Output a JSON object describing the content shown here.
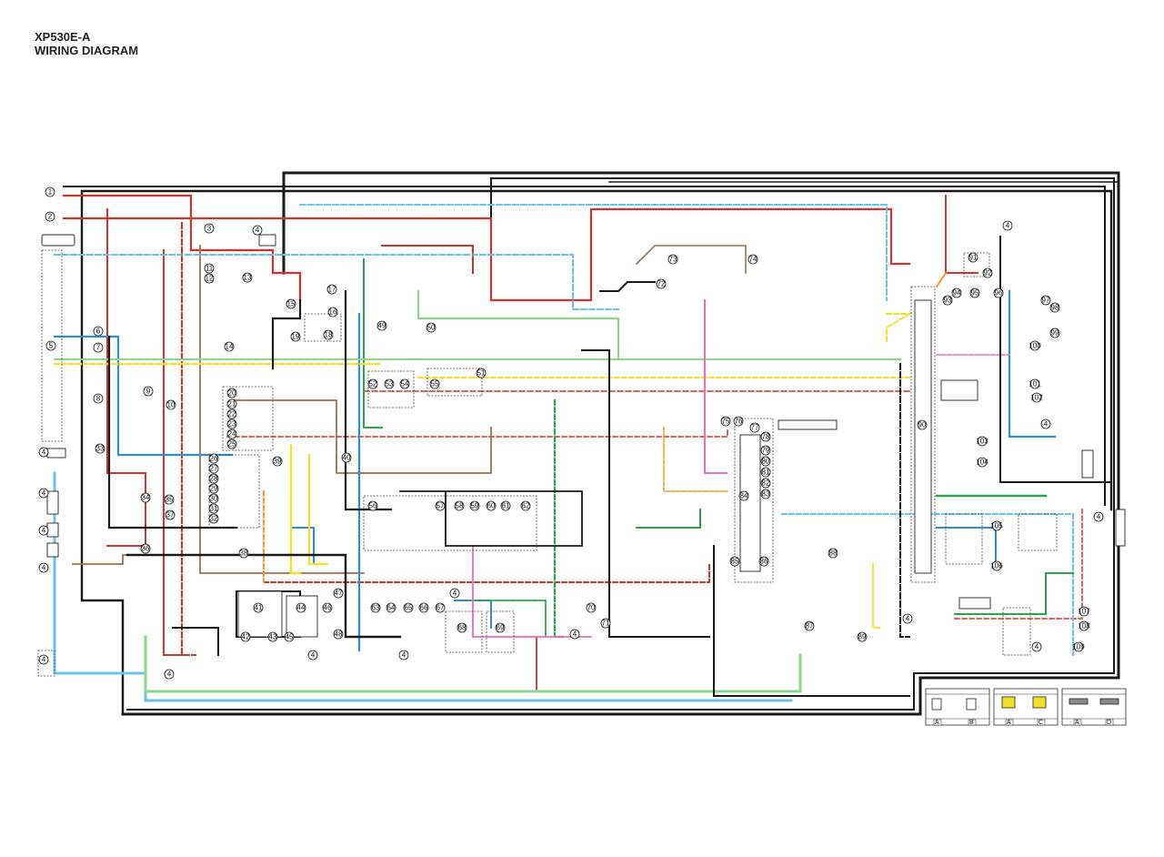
{
  "header": {
    "model": "XP530E-A",
    "title": "WIRING DIAGRAM"
  },
  "colors": {
    "black": "#1a1a1a",
    "red": "#d0342c",
    "brown": "#a0704a",
    "blue": "#2f8fd6",
    "sky_blue": "#6cc3e6",
    "green": "#2aa64a",
    "light_green": "#8fd38f",
    "yellow": "#f4df2a",
    "orange": "#f39a2b",
    "pink": "#e86fb8",
    "gray": "#8a8a8a",
    "white": "#ffffff"
  },
  "callouts": [
    "1",
    "2",
    "3",
    "4",
    "5",
    "6",
    "7",
    "8",
    "9",
    "10",
    "11",
    "12",
    "13",
    "14",
    "15",
    "16",
    "17",
    "18",
    "19",
    "20",
    "21",
    "22",
    "23",
    "24",
    "25",
    "26",
    "27",
    "28",
    "29",
    "30",
    "31",
    "32",
    "33",
    "34",
    "35",
    "36",
    "37",
    "38",
    "39",
    "40",
    "41",
    "42",
    "43",
    "44",
    "45",
    "46",
    "47",
    "48",
    "49",
    "50",
    "51",
    "52",
    "53",
    "54",
    "55",
    "56",
    "57",
    "58",
    "59",
    "60",
    "61",
    "62",
    "63",
    "64",
    "65",
    "66",
    "67",
    "68",
    "69",
    "70",
    "71",
    "72",
    "73",
    "74",
    "75",
    "76",
    "77",
    "78",
    "79",
    "80",
    "81",
    "82",
    "83",
    "84",
    "85",
    "86",
    "87",
    "88",
    "89",
    "90",
    "91",
    "92",
    "93",
    "94",
    "95",
    "96",
    "97",
    "98",
    "99",
    "100",
    "101",
    "102",
    "103",
    "104",
    "105",
    "106",
    "107",
    "108",
    "109"
  ],
  "legend": [
    {
      "name": "legend-group-1",
      "labels": [
        "A",
        "B"
      ]
    },
    {
      "name": "legend-group-2",
      "labels": [
        "A",
        "C"
      ]
    },
    {
      "name": "legend-group-3",
      "labels": [
        "A",
        "D"
      ]
    }
  ]
}
